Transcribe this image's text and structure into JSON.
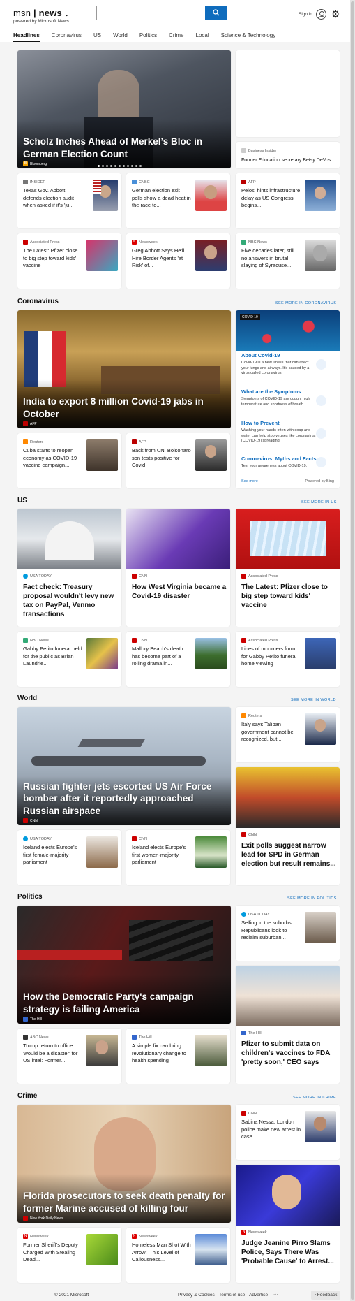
{
  "header": {
    "brand_logo": "msn",
    "brand_name": "news",
    "powered": "powered by Microsoft News",
    "search_placeholder": "",
    "signin": "Sign in"
  },
  "nav": [
    "Headlines",
    "Coronavirus",
    "US",
    "World",
    "Politics",
    "Crime",
    "Local",
    "Science & Technology"
  ],
  "hero": {
    "title": "Scholz Inches Ahead of Merkel’s Bloc in German Election Count",
    "source": "Bloomberg"
  },
  "side_top": {
    "source": "Business Insider",
    "title": "Former Education secretary Betsy DeVos..."
  },
  "row1": [
    {
      "source": "INSIDER",
      "title": "Texas Gov. Abbott defends election audit when asked if it's 'ju..."
    },
    {
      "source": "CNBC",
      "title": "German election exit polls show a dead heat in the race to..."
    },
    {
      "source": "AFP",
      "title": "Pelosi hints infrastructure delay as US Congress begins..."
    }
  ],
  "row2": [
    {
      "source": "Associated Press",
      "title": "The Latest: Pfizer close to big step toward kids' vaccine"
    },
    {
      "source": "Newsweek",
      "title": "Greg Abbott Says He'll Hire Border Agents 'at Risk' of..."
    },
    {
      "source": "NBC News",
      "title": "Five decades later, still no answers in brutal slaying of Syracuse..."
    }
  ],
  "corona": {
    "heading": "Coronavirus",
    "more": "SEE MORE IN CORONAVIRUS",
    "hero": {
      "title": "India to export 8 million Covid-19 jabs in October",
      "source": "AFP"
    },
    "cards": [
      {
        "source": "Reuters",
        "title": "Cuba starts to reopen economy as COVID-19 vaccine campaign..."
      },
      {
        "source": "AFP",
        "title": "Back from UN, Bolsonaro son tests positive for Covid"
      }
    ],
    "panel": {
      "badge": "COVID 19",
      "items": [
        {
          "h": "About Covid-19",
          "d": "Covid-19 is a new illness that can affect your lungs and airways. It's caused by a virus called coronavirus."
        },
        {
          "h": "What are the Symptoms",
          "d": "Symptoms of COVID-19 are cough, high temperature and shortness of breath."
        },
        {
          "h": "How to Prevent",
          "d": "Washing your hands often with soap and water can help stop viruses like coronavirus (COVID-19) spreading."
        },
        {
          "h": "Coronavirus: Myths and Facts",
          "d": "Test your awareness about COVID-19."
        }
      ],
      "see_more": "See more",
      "powered": "Powered by Bing"
    }
  },
  "us": {
    "heading": "US",
    "more": "SEE MORE IN US",
    "big": [
      {
        "source": "USA TODAY",
        "title": "Fact check: Treasury proposal wouldn't levy new tax on PayPal, Venmo transactions"
      },
      {
        "source": "CNN",
        "title": "How West Virginia became a Covid-19 disaster"
      },
      {
        "source": "Associated Press",
        "title": "The Latest: Pfizer close to big step toward kids' vaccine"
      }
    ],
    "small": [
      {
        "source": "NBC News",
        "title": "Gabby Petito funeral held for the public as Brian Laundrie..."
      },
      {
        "source": "CNN",
        "title": "Mallory Beach's death has become part of a rolling drama in..."
      },
      {
        "source": "Associated Press",
        "title": "Lines of mourners form for Gabby Petito funeral home viewing"
      }
    ]
  },
  "world": {
    "heading": "World",
    "more": "SEE MORE IN WORLD",
    "hero": {
      "title": "Russian fighter jets escorted US Air Force bomber after it reportedly approached Russian airspace",
      "source": "CNN"
    },
    "side": {
      "source": "Reuters",
      "title": "Italy says Taliban government cannot be recognized, but..."
    },
    "cards": [
      {
        "source": "USA TODAY",
        "title": "Iceland elects Europe's first female-majority parliament"
      },
      {
        "source": "CNN",
        "title": "Iceland elects Europe's first women-majority parliament"
      }
    ],
    "tall": {
      "source": "CNN",
      "title": "Exit polls suggest narrow lead for SPD in German election but result remains..."
    }
  },
  "politics": {
    "heading": "Politics",
    "more": "SEE MORE IN POLITICS",
    "hero": {
      "title": "How the Democratic Party's campaign strategy is failing America",
      "source": "The Hill"
    },
    "side": {
      "source": "USA TODAY",
      "title": "Selling in the suburbs: Republicans look to reclaim suburban..."
    },
    "cards": [
      {
        "source": "ABC News",
        "title": "Trump return to office 'would be a disaster' for US intel: Former..."
      },
      {
        "source": "The Hill",
        "title": "A simple fix can bring revolutionary change to health spending"
      }
    ],
    "tall": {
      "source": "The Hill",
      "title": "Pfizer to submit data on children's vaccines to FDA 'pretty soon,' CEO says"
    }
  },
  "crime": {
    "heading": "Crime",
    "more": "SEE MORE IN CRIME",
    "hero": {
      "title": "Florida prosecutors to seek death penalty for former Marine accused of killing four",
      "source": "New York Daily News"
    },
    "side": {
      "source": "CNN",
      "title": "Sabina Nessa: London police make new arrest in case"
    },
    "cards": [
      {
        "source": "Newsweek",
        "title": "Former Sheriff's Deputy Charged With Stealing Dead..."
      },
      {
        "source": "Newsweek",
        "title": "Homeless Man Shot With Arrow: 'This Level of Callousness..."
      }
    ],
    "tall": {
      "source": "Newsweek",
      "title": "Judge Jeanine Pirro Slams Police, Says There Was 'Probable Cause' to Arrest..."
    }
  },
  "footer": {
    "copyright": "© 2021 Microsoft",
    "links": [
      "Privacy & Cookies",
      "Terms of use",
      "Advertise"
    ],
    "more": "···",
    "feedback": "Feedback"
  }
}
